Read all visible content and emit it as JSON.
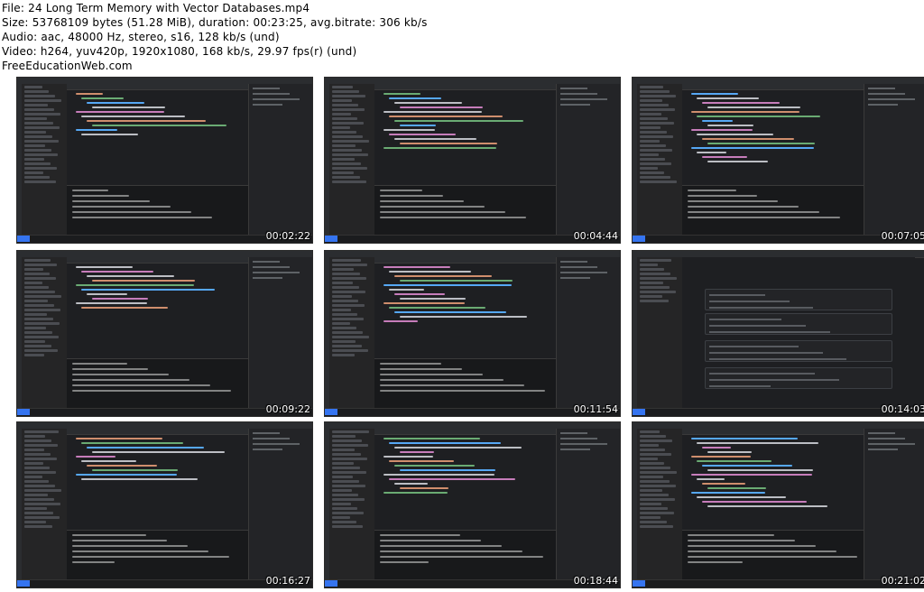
{
  "header": {
    "file": "File: 24 Long Term Memory with Vector Databases.mp4",
    "size": "Size: 53768109 bytes (51.28 MiB), duration: 00:23:25, avg.bitrate: 306 kb/s",
    "audio": "Audio: aac, 48000 Hz, stereo, s16, 128 kb/s (und)",
    "video": "Video: h264, yuv420p, 1920x1080, 168 kb/s, 29.97 fps(r) (und)",
    "site": "FreeEducationWeb.com"
  },
  "thumbnails": [
    {
      "timestamp": "00:02:22",
      "kind": "editor"
    },
    {
      "timestamp": "00:04:44",
      "kind": "editor"
    },
    {
      "timestamp": "00:07:05",
      "kind": "editor"
    },
    {
      "timestamp": "00:09:22",
      "kind": "editor"
    },
    {
      "timestamp": "00:11:54",
      "kind": "editor"
    },
    {
      "timestamp": "00:14:03",
      "kind": "settings"
    },
    {
      "timestamp": "00:16:27",
      "kind": "editor"
    },
    {
      "timestamp": "00:18:44",
      "kind": "editor"
    },
    {
      "timestamp": "00:21:02",
      "kind": "editor"
    }
  ],
  "colors": {
    "editor_bg": "#1e1f22",
    "accent": "#3574f0",
    "code_orange": "#cf8e6d",
    "code_green": "#6aab73",
    "code_blue": "#56a8f5",
    "code_white": "#bcbec4",
    "code_purple": "#c77dbb"
  }
}
